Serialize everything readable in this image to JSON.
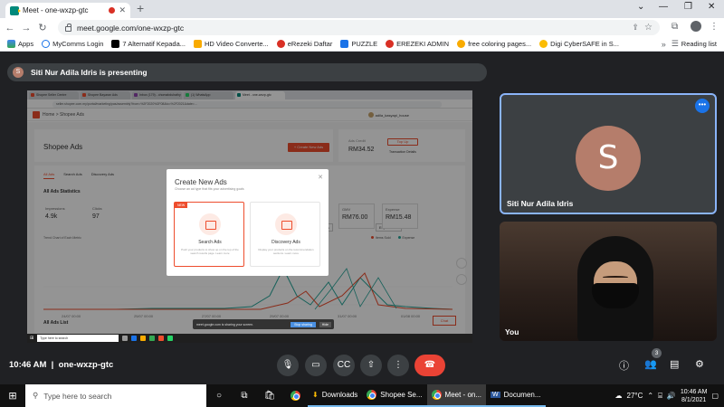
{
  "browser": {
    "tab_title": "Meet - one-wxzp-gtc",
    "url": "meet.google.com/one-wxzp-gtc",
    "bookmarks": [
      {
        "label": "Apps",
        "color": "#4285f4"
      },
      {
        "label": "MyComms Login",
        "color": "#1a73e8"
      },
      {
        "label": "7 Alternatif Kepada...",
        "color": "#000000"
      },
      {
        "label": "HD Video Converte...",
        "color": "#f9ab00"
      },
      {
        "label": "eRezeki Daftar",
        "color": "#d93025"
      },
      {
        "label": "PUZZLE",
        "color": "#1a73e8"
      },
      {
        "label": "EREZEKI ADMIN",
        "color": "#d93025"
      },
      {
        "label": "free coloring pages...",
        "color": "#f9ab00"
      },
      {
        "label": "Digi CyberSAFE in S...",
        "color": "#fbbc04"
      }
    ],
    "reading_list": "Reading list"
  },
  "meet": {
    "presenting": "Siti Nur Adila Idris is presenting",
    "presenter_initial": "S",
    "participant_name": "Siti Nur Adila Idris",
    "self_label": "You",
    "meeting_time": "10:46 AM",
    "meeting_code": "one-wxzp-gtc",
    "people_count": "3",
    "accent": "#8ab4f8",
    "end_color": "#ea4335"
  },
  "shared": {
    "tabs": [
      "Shopee Seller Centre",
      "Shopee Bayaran Ads",
      "Inbox (179) - chomabdulrathy",
      "(1) WhatsApp",
      "Meet - one-wxzp-gtc"
    ],
    "url": "seller.shopee.com.my/portal/marketing/pas/assembly?from=%2F2020%2F08&to=%2F2021&date=...",
    "crumb": "Home  >  Shopee Ads",
    "user": "adila_kasyapi_house",
    "page_title": "Shopee Ads",
    "create_btn": "+ Create New Ads",
    "balance_label": "Ads Credit",
    "balance": "RM34.52",
    "top_up": "Top Up",
    "transaction": "Transaction Details",
    "subtabs": [
      "All Ads",
      "Search Ads",
      "Discovery Ads"
    ],
    "stats_title": "All Ads Statistics",
    "metrics": [
      {
        "label": "Impressions",
        "value": "4.9k"
      },
      {
        "label": "Clicks",
        "value": "97"
      }
    ],
    "metrics_right": [
      {
        "label": "GMV",
        "value": "RM76.00"
      },
      {
        "label": "Expense",
        "value": "RM15.48"
      }
    ],
    "period": "7 days",
    "export": "Export Data",
    "trend_label": "Trend Chart of Each Metric",
    "legend": [
      "Items Sold",
      "Expense"
    ],
    "chart_dates": [
      "24/07 00:00",
      "25/07 00:00",
      "27/07 00:00",
      "29/07 00:00",
      "31/07 00:00",
      "01/08 00:00"
    ],
    "ads_list": "All Ads List",
    "chat": "Chat",
    "modal": {
      "title": "Create New Ads",
      "subtitle": "Choose an ad type that fits your advertising goals",
      "new_tag": "NEW",
      "options": [
        {
          "title": "Search Ads",
          "desc": "Push your products to show up on the top of the search results page. Learn more"
        },
        {
          "title": "Discovery Ads",
          "desc": "Display your products on the recommendation sections. Learn more"
        }
      ]
    },
    "share_bar": "meet.google.com is sharing your screen.",
    "stop_sharing": "Stop sharing",
    "hide": "Hide",
    "taskbar_search": "Type here to search"
  },
  "taskbar": {
    "search": "Type here to search",
    "apps": [
      "Downloads",
      "Shopee Se...",
      "Meet - on...",
      "Documen..."
    ],
    "weather": "27°C",
    "time": "10:46 AM",
    "date": "8/1/2021"
  }
}
